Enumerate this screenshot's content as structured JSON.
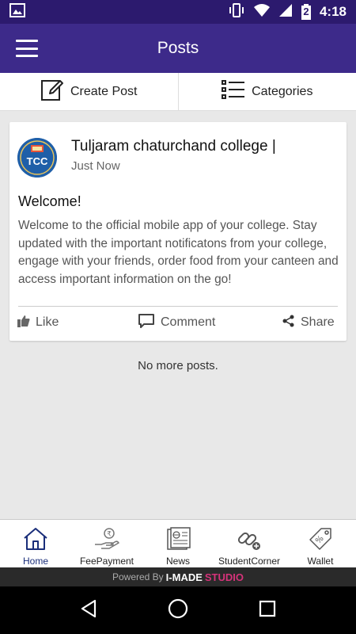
{
  "status_bar": {
    "time": "4:18",
    "battery_level": "2"
  },
  "app_bar": {
    "title": "Posts"
  },
  "actions": {
    "create_post": "Create Post",
    "categories": "Categories"
  },
  "post": {
    "avatar_text": "TCC",
    "author": "Tuljaram chaturchand college |",
    "time": "Just Now",
    "title": "Welcome!",
    "body": "Welcome to the official mobile app of your college. Stay updated with the important notificatons from your college, engage with your friends, order food from your canteen and access important information on the go!",
    "like": "Like",
    "comment": "Comment",
    "share": "Share"
  },
  "feed": {
    "end_text": "No more posts."
  },
  "bottom_nav": {
    "items": [
      {
        "label": "Home",
        "icon": "home-icon",
        "active": true
      },
      {
        "label": "FeePayment",
        "icon": "fee-payment-icon"
      },
      {
        "label": "News",
        "icon": "news-icon"
      },
      {
        "label": "StudentCorner",
        "icon": "student-corner-icon"
      },
      {
        "label": "Wallet",
        "icon": "wallet-icon"
      }
    ]
  },
  "footer": {
    "powered_by": "Powered By",
    "brand_left": "I-MADE",
    "brand_right": "STUDIO"
  },
  "colors": {
    "app_bar": "#3d2a8a",
    "status_bar": "#2c1a6e",
    "active_nav": "#1a2e7a",
    "brand_accent": "#d6337a"
  }
}
